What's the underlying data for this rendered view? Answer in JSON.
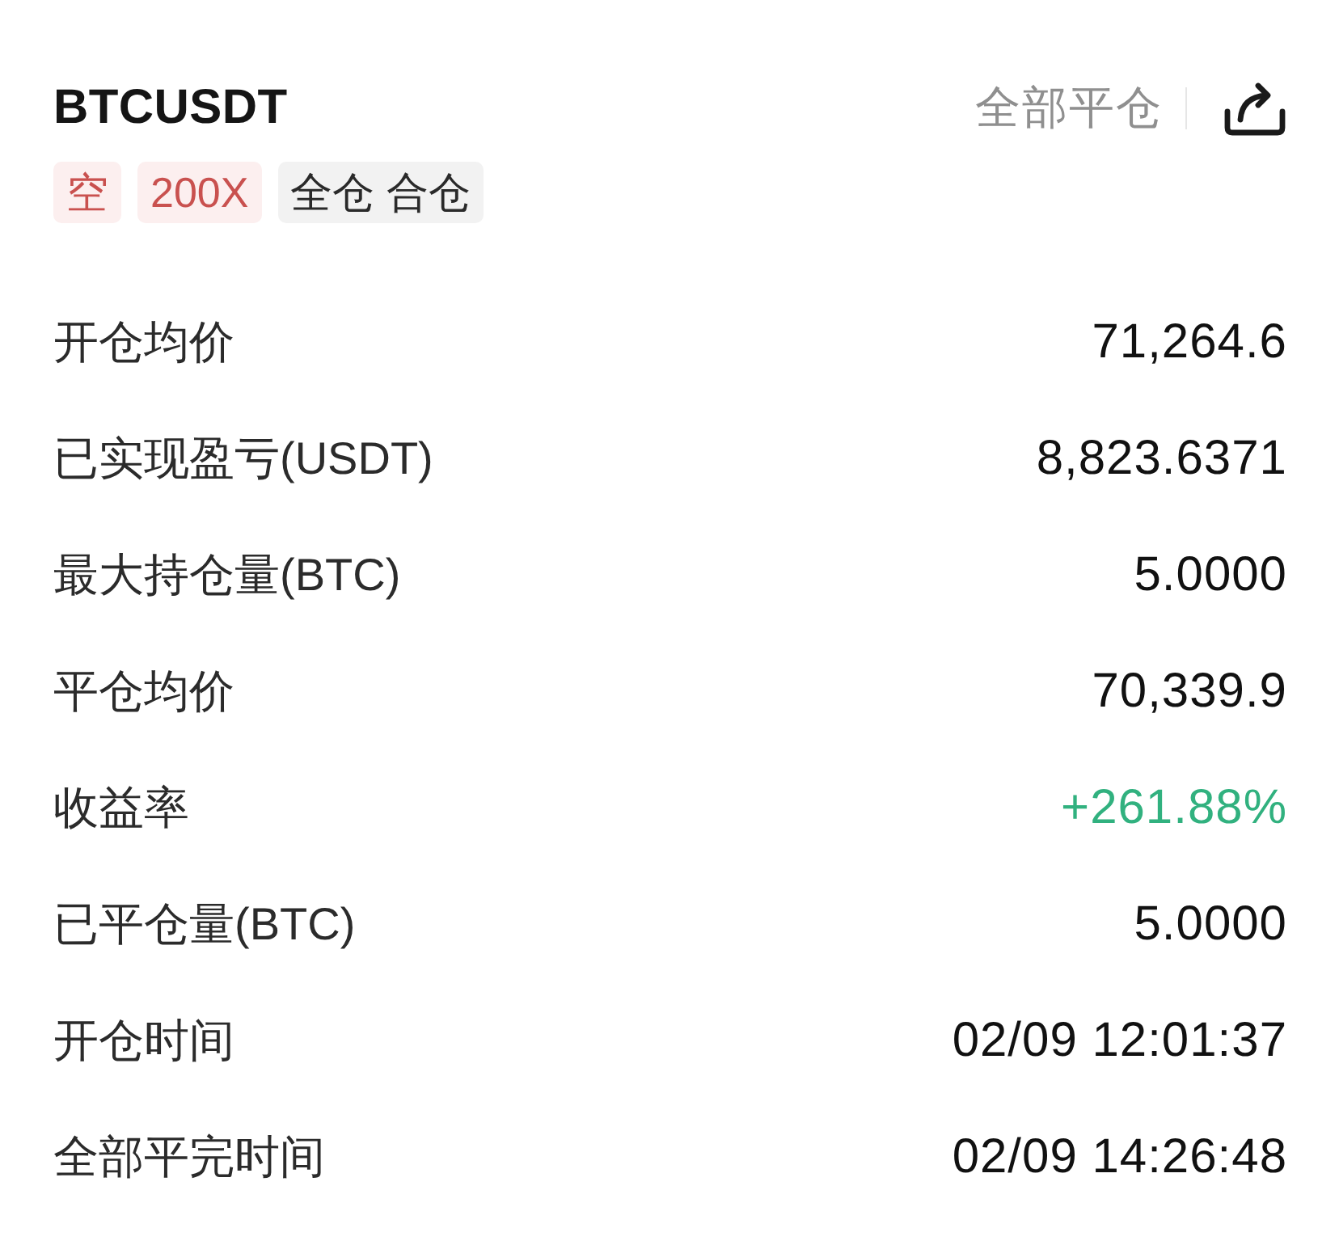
{
  "header": {
    "symbol": "BTCUSDT",
    "close_all": "全部平仓"
  },
  "tags": [
    {
      "label": "空",
      "kind": "accent"
    },
    {
      "label": "200X",
      "kind": "accent"
    },
    {
      "label": "全仓 合仓",
      "kind": "neutral"
    }
  ],
  "rows": [
    {
      "label": "开仓均价",
      "value": "71,264.6",
      "kind": "plain"
    },
    {
      "label": "已实现盈亏(USDT)",
      "value": "8,823.6371",
      "kind": "plain"
    },
    {
      "label": "最大持仓量(BTC)",
      "value": "5.0000",
      "kind": "plain"
    },
    {
      "label": "平仓均价",
      "value": "70,339.9",
      "kind": "plain"
    },
    {
      "label": "收益率",
      "value": "+261.88%",
      "kind": "positive"
    },
    {
      "label": "已平仓量(BTC)",
      "value": "5.0000",
      "kind": "plain"
    },
    {
      "label": "开仓时间",
      "value": "02/09 12:01:37",
      "kind": "plain"
    },
    {
      "label": "全部平完时间",
      "value": "02/09 14:26:48",
      "kind": "plain"
    }
  ]
}
